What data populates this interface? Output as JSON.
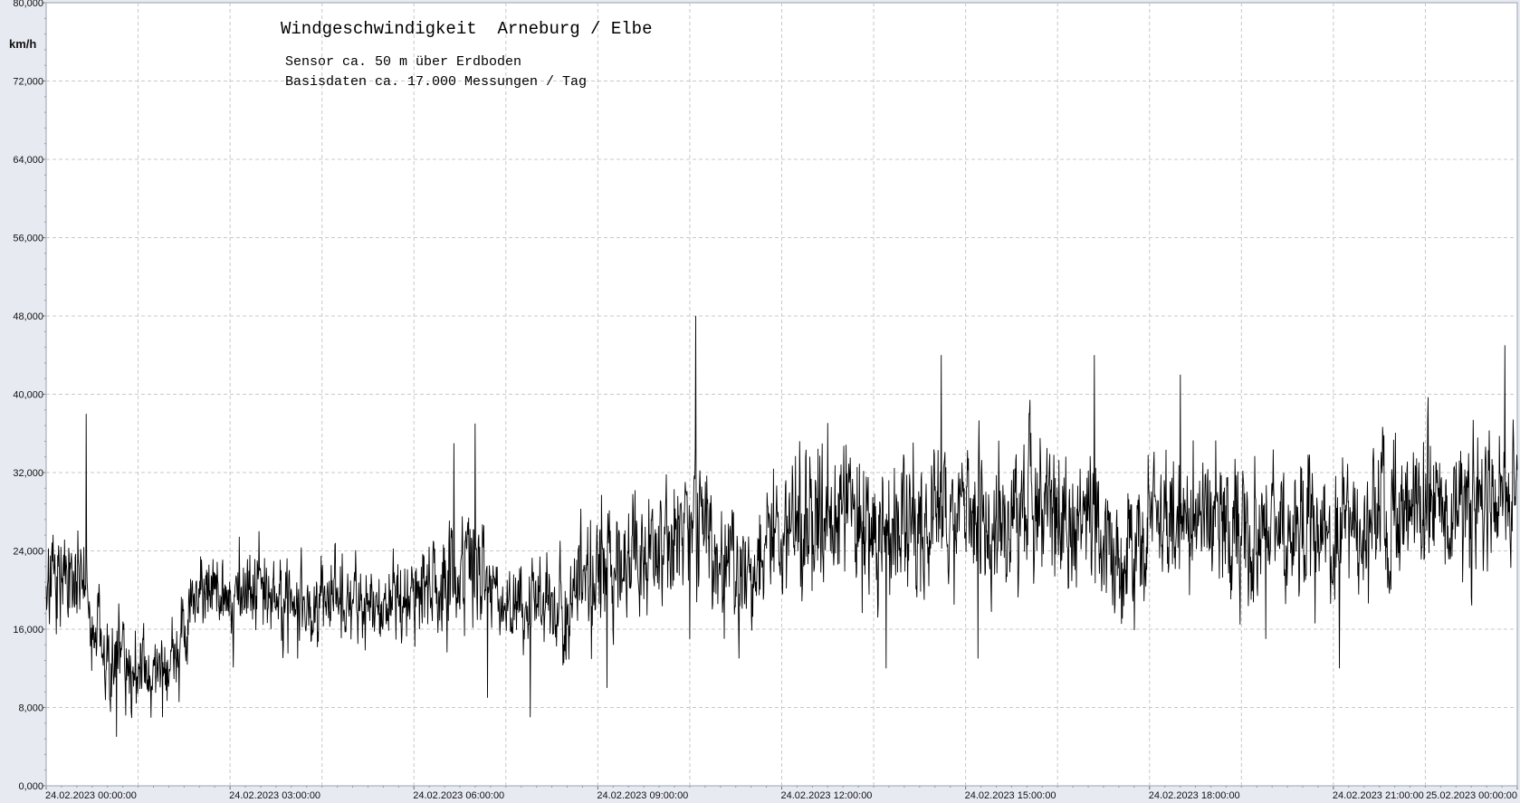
{
  "chart_data": {
    "type": "line",
    "title": "Windgeschwindigkeit  Arneburg / Elbe",
    "subtitle_lines": [
      "Sensor ca. 50 m über Erdboden",
      "Basisdaten ca. 17.000 Messungen / Tag"
    ],
    "ylabel": "km/h",
    "xlabel": "",
    "ylim": [
      0,
      80
    ],
    "y_ticks": [
      {
        "value": 0,
        "label": "0,000"
      },
      {
        "value": 8,
        "label": "8,000"
      },
      {
        "value": 16,
        "label": "16,000"
      },
      {
        "value": 24,
        "label": "24,000"
      },
      {
        "value": 32,
        "label": "32,000"
      },
      {
        "value": 40,
        "label": "40,000"
      },
      {
        "value": 48,
        "label": "48,000"
      },
      {
        "value": 56,
        "label": "56,000"
      },
      {
        "value": 64,
        "label": "64,000"
      },
      {
        "value": 72,
        "label": "72,000"
      },
      {
        "value": 80,
        "label": "80,000"
      }
    ],
    "xlim_hours": [
      0,
      24
    ],
    "x_ticks": [
      {
        "hour": 0,
        "label": "24.02.2023  00:00:00"
      },
      {
        "hour": 3,
        "label": "24.02.2023  03:00:00"
      },
      {
        "hour": 6,
        "label": "24.02.2023  06:00:00"
      },
      {
        "hour": 9,
        "label": "24.02.2023  09:00:00"
      },
      {
        "hour": 12,
        "label": "24.02.2023  12:00:00"
      },
      {
        "hour": 15,
        "label": "24.02.2023  15:00:00"
      },
      {
        "hour": 18,
        "label": "24.02.2023  18:00:00"
      },
      {
        "hour": 21,
        "label": "24.02.2023  21:00:00"
      },
      {
        "hour": 24,
        "label": "25.02.2023  00:00:00"
      }
    ],
    "grid": true,
    "series": [
      {
        "color": "#000000",
        "x_hours": [
          0,
          0.5,
          1,
          1.5,
          2,
          2.5,
          3,
          3.5,
          4,
          4.5,
          5,
          5.5,
          6,
          6.5,
          7,
          7.5,
          8,
          8.5,
          9,
          9.5,
          10,
          10.5,
          11,
          11.5,
          12,
          12.5,
          13,
          13.5,
          14,
          14.5,
          15,
          15.5,
          16,
          16.5,
          17,
          17.5,
          18,
          18.5,
          19,
          19.5,
          20,
          20.5,
          21,
          21.5,
          22,
          22.5,
          23,
          23.5,
          24
        ],
        "mean_kmh": [
          21,
          22,
          13,
          12,
          11.5,
          20,
          20,
          19.5,
          19,
          18.5,
          19,
          19.5,
          19,
          21,
          22,
          19,
          18,
          20,
          22,
          23,
          24,
          28,
          23,
          22,
          26,
          27,
          28,
          26,
          27,
          28,
          28,
          27,
          28,
          27,
          27,
          23,
          26,
          27,
          27,
          26,
          27,
          26,
          25,
          27,
          29,
          29,
          28,
          28,
          29
        ],
        "spread_kmh": [
          7,
          8,
          6,
          5,
          5,
          5,
          6,
          6,
          6,
          6,
          6,
          6,
          6,
          7,
          7,
          6,
          6,
          7,
          8,
          8,
          8,
          10,
          9,
          9,
          9,
          10,
          10,
          10,
          10,
          10,
          10,
          10,
          10,
          10,
          10,
          9,
          9,
          9,
          9,
          9,
          9,
          9,
          9,
          9,
          10,
          10,
          9,
          9,
          9
        ],
        "extreme_peaks": [
          {
            "hour": 0.65,
            "value": 38
          },
          {
            "hour": 1.15,
            "value": 5
          },
          {
            "hour": 1.9,
            "value": 7
          },
          {
            "hour": 4.1,
            "value": 13
          },
          {
            "hour": 6.65,
            "value": 35
          },
          {
            "hour": 7.0,
            "value": 37
          },
          {
            "hour": 7.2,
            "value": 9
          },
          {
            "hour": 7.9,
            "value": 7
          },
          {
            "hour": 9.15,
            "value": 10
          },
          {
            "hour": 10.6,
            "value": 48
          },
          {
            "hour": 10.5,
            "value": 15
          },
          {
            "hour": 11.3,
            "value": 13
          },
          {
            "hour": 13.7,
            "value": 12
          },
          {
            "hour": 14.6,
            "value": 44
          },
          {
            "hour": 15.2,
            "value": 13
          },
          {
            "hour": 17.1,
            "value": 44
          },
          {
            "hour": 18.5,
            "value": 42
          },
          {
            "hour": 19.9,
            "value": 15
          },
          {
            "hour": 21.1,
            "value": 12
          },
          {
            "hour": 23.8,
            "value": 45
          }
        ]
      }
    ]
  }
}
